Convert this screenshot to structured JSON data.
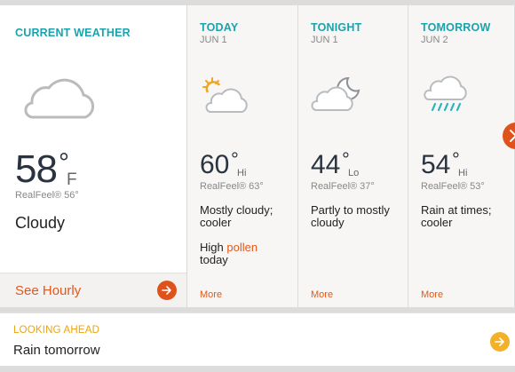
{
  "current": {
    "heading": "CURRENT WEATHER",
    "icon": "cloud-icon",
    "temp": "58",
    "deg": "°",
    "unit": "F",
    "realfeel": "RealFeel® 56°",
    "condition": "Cloudy",
    "hourly_label": "See Hourly"
  },
  "forecast": [
    {
      "title": "TODAY",
      "date": "JUN 1",
      "icon": "partly-sunny-icon",
      "temp": "60",
      "deg": "°",
      "hilo": "Hi",
      "realfeel": "RealFeel® 63°",
      "condition": "Mostly cloudy; cooler",
      "pollen_prefix": "High ",
      "pollen_word": "pollen",
      "pollen_suffix": "today",
      "more": "More"
    },
    {
      "title": "TONIGHT",
      "date": "JUN 1",
      "icon": "partly-cloudy-night-icon",
      "temp": "44",
      "deg": "°",
      "hilo": "Lo",
      "realfeel": "RealFeel® 37°",
      "condition": "Partly to mostly cloudy",
      "more": "More"
    },
    {
      "title": "TOMORROW",
      "date": "JUN 2",
      "icon": "rain-icon",
      "temp": "54",
      "deg": "°",
      "hilo": "Hi",
      "realfeel": "RealFeel® 53°",
      "condition": "Rain at times; cooler",
      "more": "More"
    }
  ],
  "looking_ahead": {
    "label": "LOOKING AHEAD",
    "text": "Rain tomorrow"
  },
  "colors": {
    "accent_teal": "#1aa3ad",
    "accent_orange": "#e0521c",
    "accent_yellow": "#f3b12a"
  }
}
